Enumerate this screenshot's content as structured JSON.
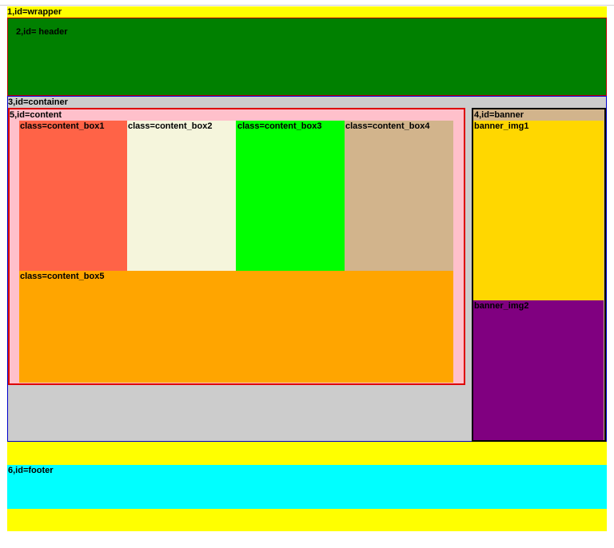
{
  "wrapper": {
    "label": "1,id=wrapper"
  },
  "header": {
    "label": "2,id= header"
  },
  "container": {
    "label": "3,id=container"
  },
  "banner": {
    "label": "4,id=banner",
    "img1_label": "banner_img1",
    "img2_label": "banner_img2"
  },
  "content": {
    "label": "5,id=content",
    "boxes": [
      {
        "label": "class=content_box1"
      },
      {
        "label": "class=content_box2"
      },
      {
        "label": "class=content_box3"
      },
      {
        "label": "class=content_box4"
      },
      {
        "label": "class=content_box5"
      }
    ]
  },
  "footer": {
    "label": "6,id=footer"
  },
  "colors": {
    "wrapper": "#ffff00",
    "header": "#008000",
    "container": "#cccccc",
    "content": "#ffc0cb",
    "box1": "#ff6347",
    "box2": "#f5f5dc",
    "box3": "#00ff00",
    "box4": "#d2b48c",
    "box5": "#ffa500",
    "banner": "#d2b48c",
    "banner_img1": "#ffd700",
    "banner_img2": "#800080",
    "footer": "#00ffff"
  }
}
